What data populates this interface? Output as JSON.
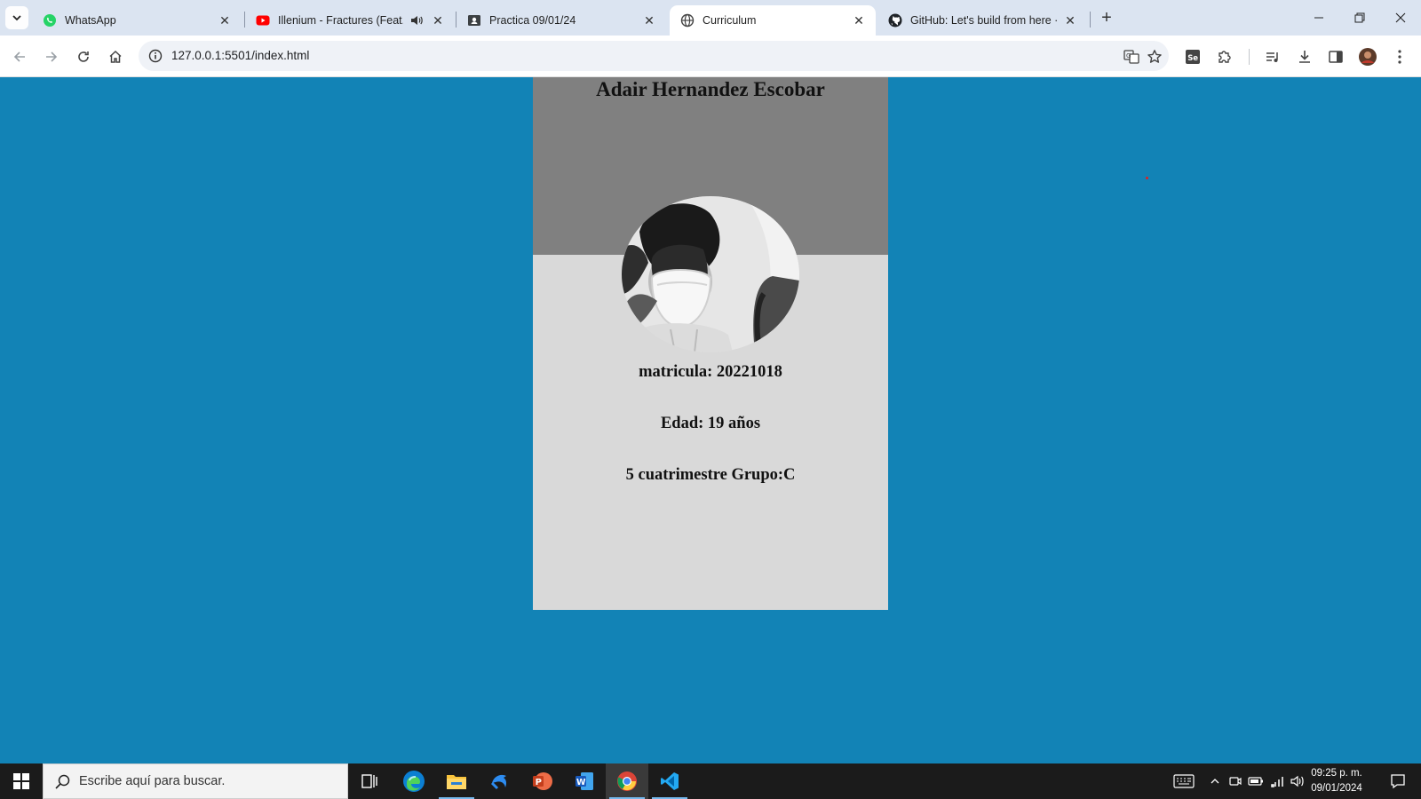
{
  "browser": {
    "tabs": [
      {
        "title": "WhatsApp",
        "icon": "whatsapp-icon",
        "active": false
      },
      {
        "title": "Illenium - Fractures (Feat. N",
        "icon": "youtube-icon",
        "active": false,
        "audio": true
      },
      {
        "title": "Practica 09/01/24",
        "icon": "contact-card-icon",
        "active": false
      },
      {
        "title": "Curriculum",
        "icon": "globe-icon",
        "active": true
      },
      {
        "title": "GitHub: Let's build from here · G",
        "icon": "github-icon",
        "active": false
      }
    ],
    "new_tab_label": "+",
    "url": "127.0.0.1:5501/index.html"
  },
  "page": {
    "name": "Adair Hernandez Escobar",
    "matricula": "matricula: 20221018",
    "edad": "Edad: 19 años",
    "grupo": "5 cuatrimestre Grupo:C"
  },
  "colors": {
    "page_background": "#1283b6",
    "card_background": "#d9d9d9",
    "card_header": "#808080"
  },
  "taskbar": {
    "search_placeholder": "Escribe aquí para buscar.",
    "apps": [
      "task-view-icon",
      "edge-icon",
      "file-explorer-icon",
      "app-arrow-icon",
      "powerpoint-icon",
      "word-icon",
      "chrome-icon",
      "vscode-icon"
    ],
    "time": "09:25 p. m.",
    "date": "09/01/2024"
  }
}
